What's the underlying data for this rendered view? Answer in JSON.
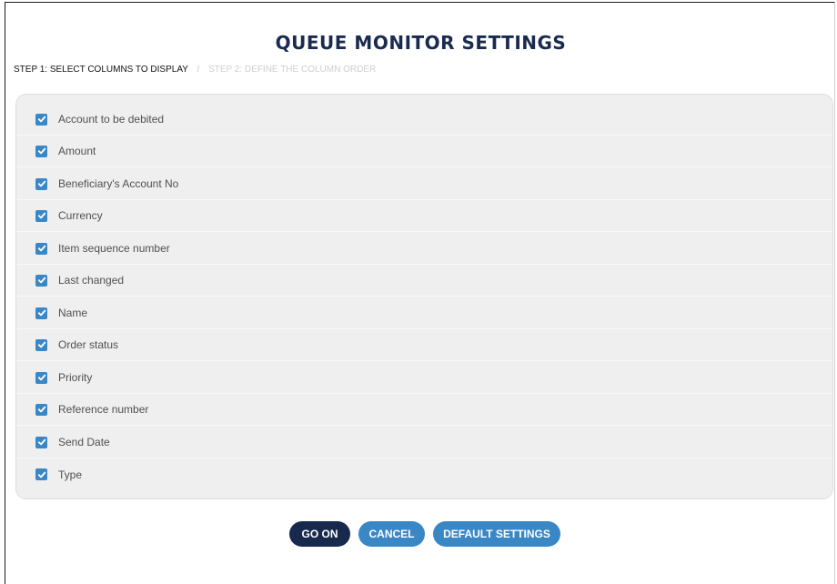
{
  "dialog": {
    "title": "QUEUE MONITOR SETTINGS",
    "steps": {
      "active": "STEP 1: SELECT COLUMNS TO DISPLAY",
      "separator": "/",
      "inactive": "STEP 2: DEFINE THE COLUMN ORDER"
    }
  },
  "columns": [
    {
      "label": "Account to be debited",
      "checked": true
    },
    {
      "label": "Amount",
      "checked": true
    },
    {
      "label": "Beneficiary's Account No",
      "checked": true
    },
    {
      "label": "Currency",
      "checked": true
    },
    {
      "label": "Item sequence number",
      "checked": true
    },
    {
      "label": "Last changed",
      "checked": true
    },
    {
      "label": "Name",
      "checked": true
    },
    {
      "label": "Order status",
      "checked": true
    },
    {
      "label": "Priority",
      "checked": true
    },
    {
      "label": "Reference number",
      "checked": true
    },
    {
      "label": "Send Date",
      "checked": true
    },
    {
      "label": "Type",
      "checked": true
    }
  ],
  "buttons": {
    "go_on": "GO ON",
    "cancel": "CANCEL",
    "default_settings": "DEFAULT SETTINGS"
  },
  "colors": {
    "title": "#1a2b4f",
    "checkbox": "#3a87c6",
    "primary_button": "#172a4d",
    "secondary_button": "#3a87c6",
    "panel_bg": "#efefef"
  },
  "icons": {
    "checkbox": "checkmark-icon"
  }
}
